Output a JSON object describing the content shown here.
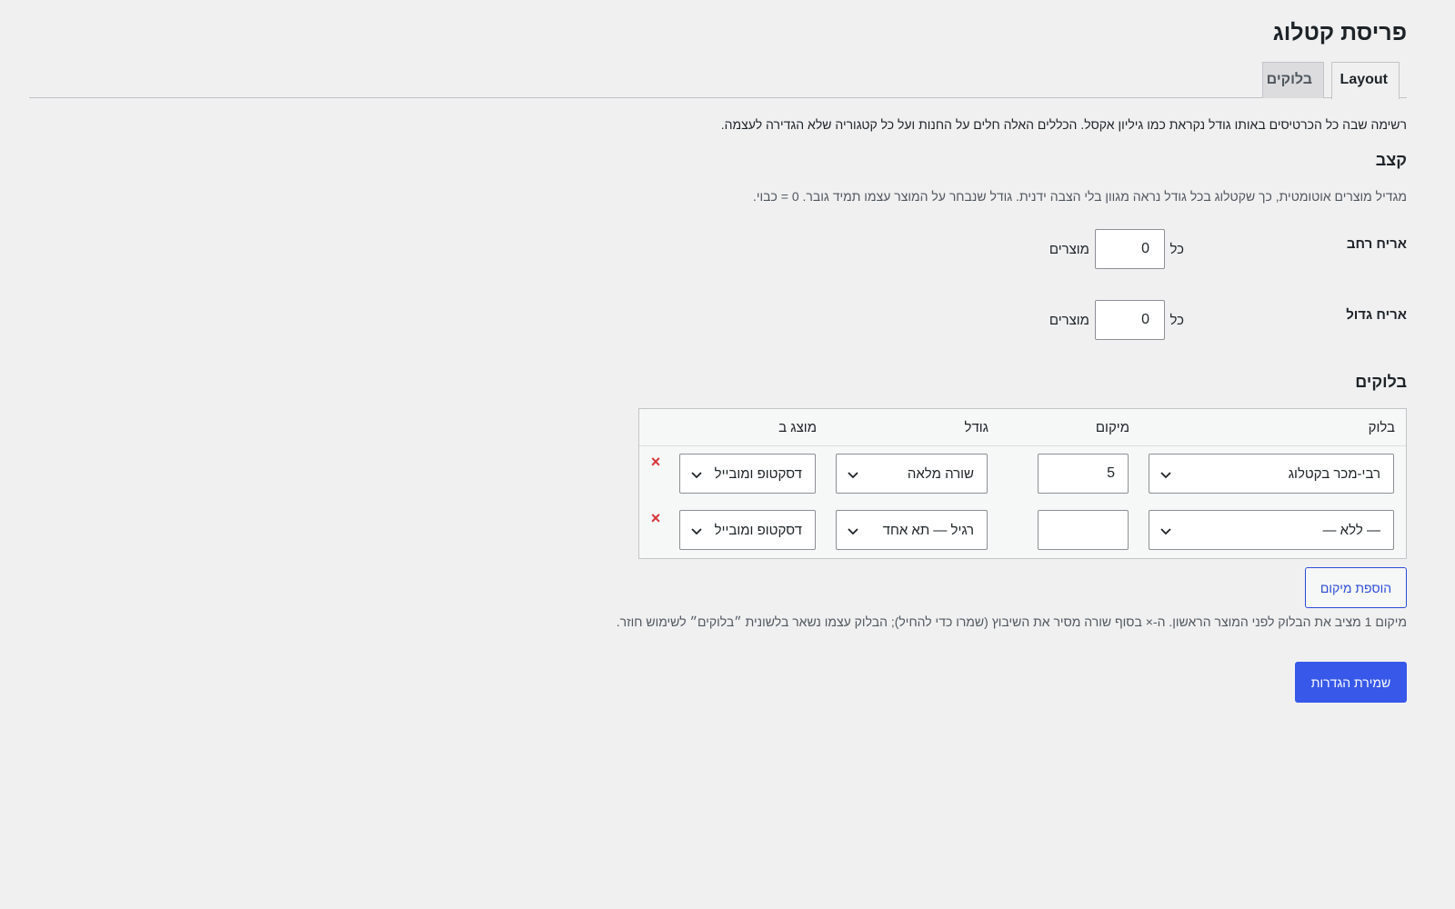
{
  "page": {
    "title": "פריסת קטלוג"
  },
  "tabs": [
    {
      "label": "Layout",
      "active": true
    },
    {
      "label": "בלוקים",
      "active": false
    }
  ],
  "intro": "רשימה שבה כל הכרטיסים באותו גודל נקראת כמו גיליון אקסל. הכללים האלה חלים על החנות ועל כל קטגוריה שלא הגדירה לעצמה.",
  "cadence": {
    "title": "קצב",
    "description": "מגדיל מוצרים אוטומטית, כך שקטלוג בכל גודל נראה מגוון בלי הצבה ידנית. גודל שנבחר על המוצר עצמו תמיד גובר. 0 = כבוי.",
    "fields": [
      {
        "label": "אריח רחב",
        "prefix": "כל",
        "value": "0",
        "suffix": "מוצרים"
      },
      {
        "label": "אריח גדול",
        "prefix": "כל",
        "value": "0",
        "suffix": "מוצרים"
      }
    ]
  },
  "blocks": {
    "title": "בלוקים",
    "columns": {
      "block": "בלוק",
      "position": "מיקום",
      "size": "גודל",
      "shown_on": "מוצג ב"
    },
    "rows": [
      {
        "block": "רבי-מכר בקטלוג",
        "position": "5",
        "size": "שורה מלאה",
        "shown_on": "דסקטופ ומובייל"
      },
      {
        "block": "— ללא —",
        "position": "",
        "size": "רגיל — תא אחד",
        "shown_on": "דסקטופ ומובייל"
      }
    ],
    "add_label": "הוספת מיקום",
    "hint": "מיקום 1 מציב את הבלוק לפני המוצר הראשון. ה-× בסוף שורה מסיר את השיבוץ (שמרו כדי להחיל); הבלוק עצמו נשאר בלשונית ״בלוקים״ לשימוש חוזר.",
    "remove_symbol": "×"
  },
  "save_label": "שמירת הגדרות",
  "colors": {
    "accent": "#3858e9",
    "danger": "#d63638",
    "background": "#f0f0f1"
  }
}
